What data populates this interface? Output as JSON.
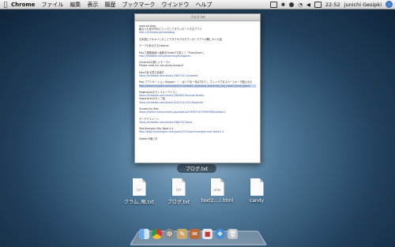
{
  "menubar": {
    "apple": "",
    "app_name": "Chrome",
    "items": [
      "ファイル",
      "編集",
      "表示",
      "履歴",
      "ブックマーク",
      "ウインドウ",
      "ヘルプ"
    ],
    "time": "22:52",
    "user": "junichi Gesipki"
  },
  "quicklook": {
    "title": "ブログ.txt",
    "caption": "ブログ.txt",
    "lines": [
      "aaaa.txt blog",
      "観る人も見ずPDFにリンクしてダウンロードするアプリ",
      "http://200ideas.jp/homeblog",
      "",
      "日本語にクオキバしたことでサクサクのダウンローアプリが勝しかった話",
      "",
      "テーブのあなたもHalyme",
      "",
      "Macで複数画面へ画像をFinder3で探して「TrackZoom」",
      "http://dribbble.com/jdnacheng/indoganle",
      "",
      "Chrome2の新しいテーマレ",
      "Please need ivy use james browns?",
      "",
      "Macのある見た目紹介",
      "https://dribbble.com/shots/1380710-Compares",
      "",
      "Mac アプリケーションSkipper・・・はトクを一気片付けて。ウィンドウをスペースキーで囲えるの",
      "http://www.youtube.com/watch?v=ashoom_keyboard_shortcuts_you_never_know_about",
      "",
      "Powershellのディスキーアイコン",
      "https://dribbble.com/shots/1380800-Youtube-Button",
      "Powershellのタップ品",
      "https://dribbble.com/shots/1442224-OS-X-Yosemite",
      "",
      "Unread for iPad",
      "https://twitter.com/unread_app/status/47636734799997864/photo/1",
      "",
      "ゲーテドエメーン",
      "https://dribbble.com/shots/1386132-Dscut",
      "",
      "Pod Wrangler Mac Beta 0.4",
      "http://blog.herbrangler.com/posts/2014/pod-wrangler-mac-beta-0-4",
      "",
      "Fiddlerの使い方"
    ]
  },
  "desktop_files": [
    {
      "name": "クラム..眼.txt",
      "ext": "TXT"
    },
    {
      "name": "ブログ.txt",
      "ext": "TXT"
    },
    {
      "name": "text2....l.html",
      "ext": "HTML"
    },
    {
      "name": "candy",
      "ext": ""
    }
  ],
  "dock": [
    "finder-icon",
    "chrome-icon",
    "preferences-icon",
    "pen-icon",
    "stamp-icon",
    "calendar-icon",
    "safari-icon",
    "trash-icon"
  ]
}
